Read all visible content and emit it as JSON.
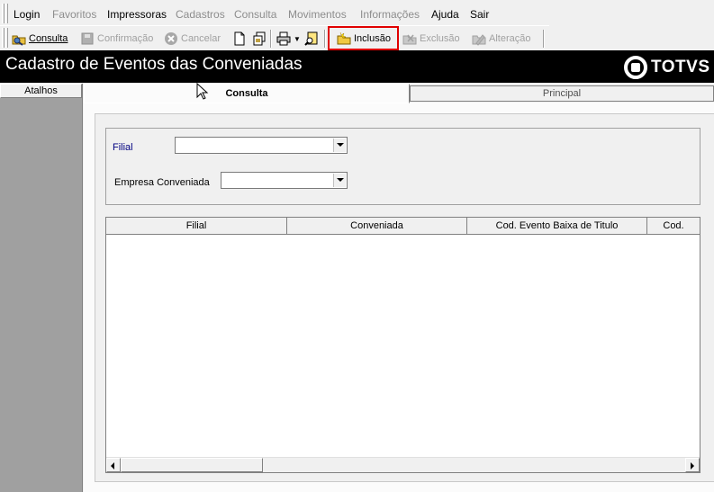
{
  "menu": {
    "items": [
      {
        "label": "Login",
        "enabled": true
      },
      {
        "label": "Favoritos",
        "enabled": false
      },
      {
        "label": "Impressoras",
        "enabled": true
      },
      {
        "label": "Cadastros",
        "enabled": false
      },
      {
        "label": "Consulta",
        "enabled": false
      },
      {
        "label": "Movimentos",
        "enabled": false
      },
      {
        "label": "Informações",
        "enabled": false
      },
      {
        "label": "Ajuda",
        "enabled": true
      },
      {
        "label": "Sair",
        "enabled": true
      }
    ]
  },
  "toolbar": {
    "consulta": "Consulta",
    "confirmacao": "Confirmação",
    "cancelar": "Cancelar",
    "inclusao": "Inclusão",
    "exclusao": "Exclusão",
    "alteracao": "Alteração",
    "highlight_color": "#e00000"
  },
  "title": "Cadastro de Eventos das Conveniadas",
  "logo": "TOTVS",
  "sidebar": {
    "header": "Atalhos"
  },
  "tabs": [
    {
      "label": "Consulta",
      "active": true
    },
    {
      "label": "Principal",
      "active": false
    }
  ],
  "filters": {
    "filial_label": "Filial",
    "filial_value": "",
    "empresa_label": "Empresa Conveniada",
    "empresa_value": ""
  },
  "grid": {
    "columns": [
      "Filial",
      "Conveniada",
      "Cod. Evento Baixa de Titulo",
      "Cod."
    ],
    "rows": []
  },
  "colors": {
    "title_bar": "#000000",
    "sidebar": "#a0a0a0",
    "filial_label": "#000080"
  }
}
